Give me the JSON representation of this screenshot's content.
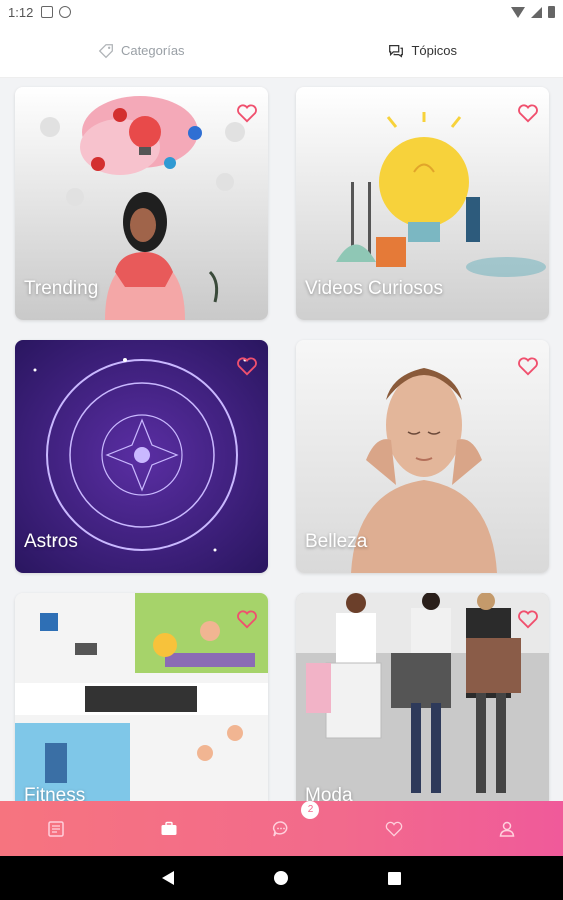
{
  "status_bar": {
    "time": "1:12"
  },
  "top_tabs": [
    {
      "label": "Categorías",
      "icon": "tag-icon",
      "active": false
    },
    {
      "label": "Tópicos",
      "icon": "chat-bubbles-icon",
      "active": true
    }
  ],
  "cards": [
    {
      "label": "Trending"
    },
    {
      "label": "Videos Curiosos"
    },
    {
      "label": "Astros"
    },
    {
      "label": "Belleza"
    },
    {
      "label": "Fitness"
    },
    {
      "label": "Moda"
    }
  ],
  "bottom_nav": {
    "items": [
      "news-icon",
      "briefcase-icon",
      "chat-icon",
      "heart-icon",
      "user-icon"
    ],
    "chat_badge": "2"
  },
  "colors": {
    "accent": "#f26a8c",
    "heart": "#f0506e"
  }
}
